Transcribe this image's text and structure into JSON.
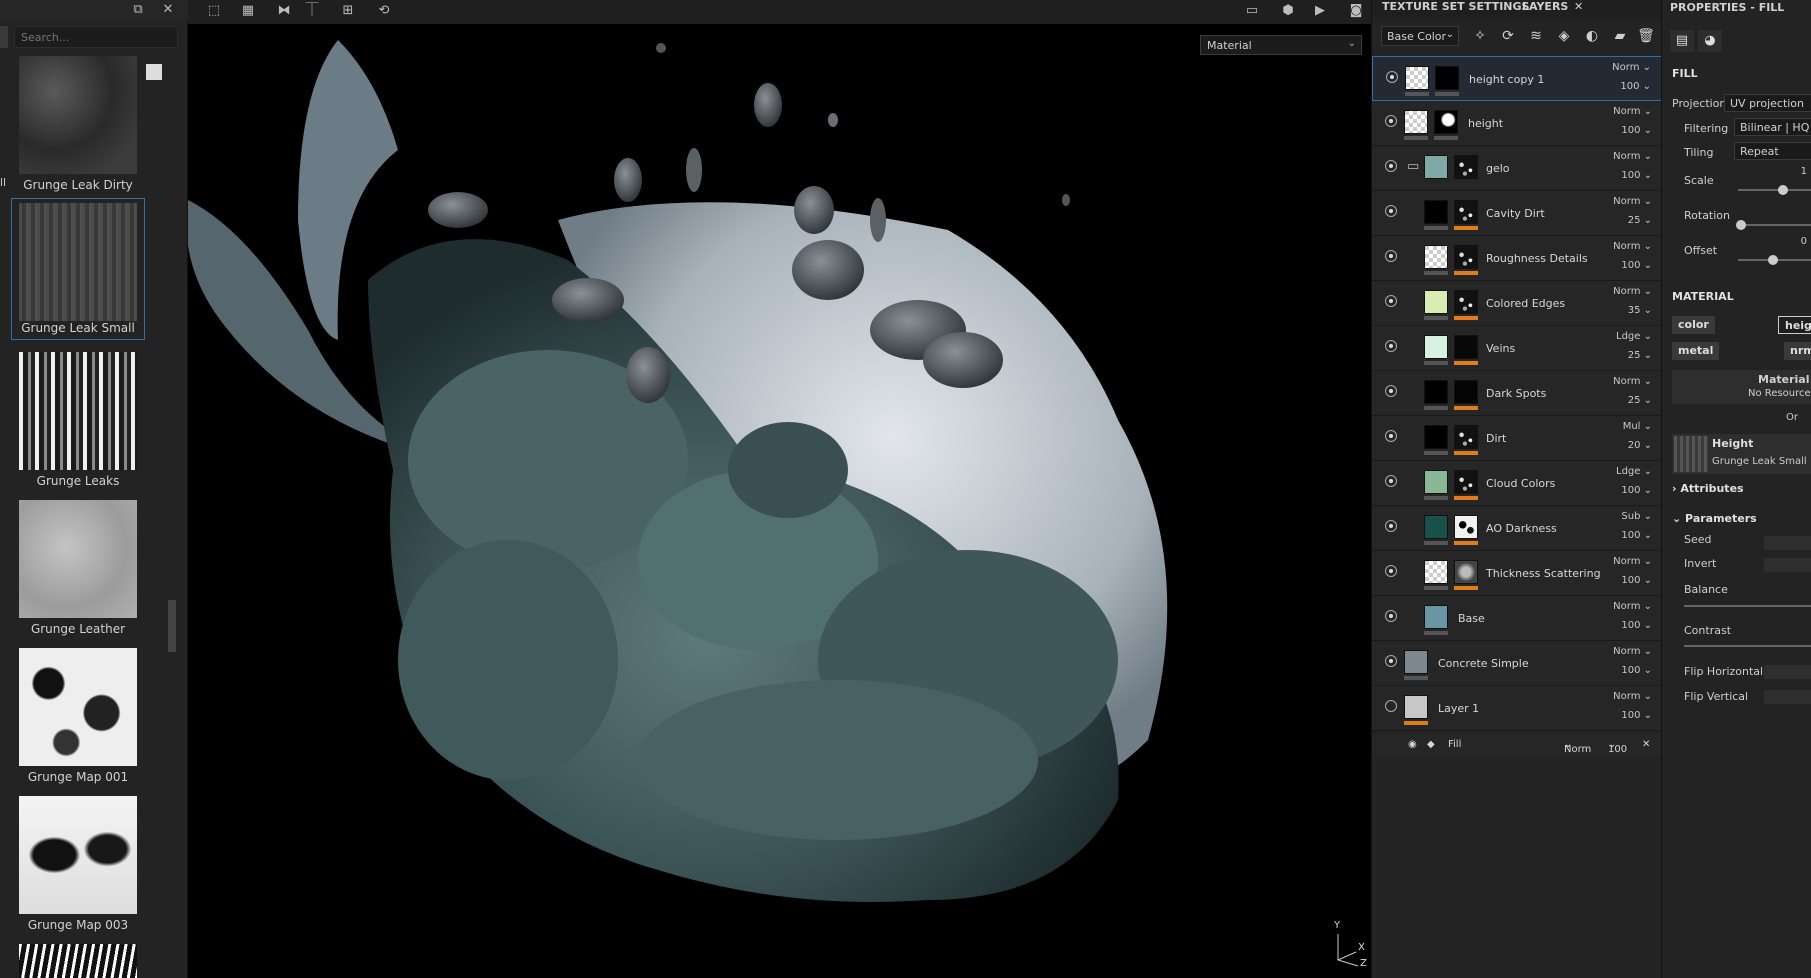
{
  "shelf": {
    "search_placeholder": "Search...",
    "thumbs": [
      {
        "label": "Grunge Leak Dirty"
      },
      {
        "label": "Grunge Leak Small"
      },
      {
        "label": "Grunge Leaks"
      },
      {
        "label": "Grunge Leather"
      },
      {
        "label": "Grunge Map 001"
      },
      {
        "label": "Grunge Map 003"
      }
    ],
    "edge_char": "ll"
  },
  "viewport": {
    "display_mode": "Material",
    "axis_y": "Y",
    "axis_x": "X",
    "axis_z": "Z"
  },
  "layers_panel": {
    "tab_texture_set": "TEXTURE SET SETTINGS",
    "tab_layers": "LAYERS",
    "close": "✕",
    "channel": "Base Color",
    "layers": [
      {
        "name": "height copy 1",
        "blend": "Norm",
        "opacity": "100"
      },
      {
        "name": "height",
        "blend": "Norm",
        "opacity": "100"
      },
      {
        "name": "gelo",
        "blend": "Norm",
        "opacity": "100"
      },
      {
        "name": "Cavity Dirt",
        "blend": "Norm",
        "opacity": "25"
      },
      {
        "name": "Roughness Details",
        "blend": "Norm",
        "opacity": "100"
      },
      {
        "name": "Colored Edges",
        "blend": "Norm",
        "opacity": "35"
      },
      {
        "name": "Veins",
        "blend": "Ldge",
        "opacity": "25"
      },
      {
        "name": "Dark Spots",
        "blend": "Norm",
        "opacity": "25"
      },
      {
        "name": "Dirt",
        "blend": "Mul",
        "opacity": "20"
      },
      {
        "name": "Cloud Colors",
        "blend": "Ldge",
        "opacity": "100"
      },
      {
        "name": "AO Darkness",
        "blend": "Sub",
        "opacity": "100"
      },
      {
        "name": "Thickness Scattering",
        "blend": "Norm",
        "opacity": "100"
      },
      {
        "name": "Base",
        "blend": "Norm",
        "opacity": "100"
      },
      {
        "name": "Concrete Simple",
        "blend": "Norm",
        "opacity": "100"
      },
      {
        "name": "Layer 1",
        "blend": "Norm",
        "opacity": "100"
      }
    ],
    "fill": {
      "name": "Fill",
      "blend": "Norm",
      "opacity": "100"
    }
  },
  "properties": {
    "title": "PROPERTIES - FILL",
    "fill_header": "FILL",
    "projection_label": "Projection",
    "projection_value": "UV projection",
    "filtering_label": "Filtering",
    "filtering_value": "Bilinear | HQ",
    "tiling_label": "Tiling",
    "tiling_value": "Repeat",
    "scale_label": "Scale",
    "scale_value": "1",
    "rotation_label": "Rotation",
    "offset_label": "Offset",
    "offset_value": "0",
    "material_header": "MATERIAL",
    "chip_color": "color",
    "chip_height": "heigh",
    "chip_metal": "metal",
    "chip_nrm": "nrm",
    "material_resource": "Material r",
    "no_resource": "No Resource",
    "or_label": "Or",
    "height_title": "Height",
    "height_sub": "Grunge Leak Small",
    "attributes": "Attributes",
    "parameters": "Parameters",
    "seed": "Seed",
    "invert": "Invert",
    "balance": "Balance",
    "contrast": "Contrast",
    "flip_h": "Flip Horizontal",
    "flip_v": "Flip Vertical"
  }
}
